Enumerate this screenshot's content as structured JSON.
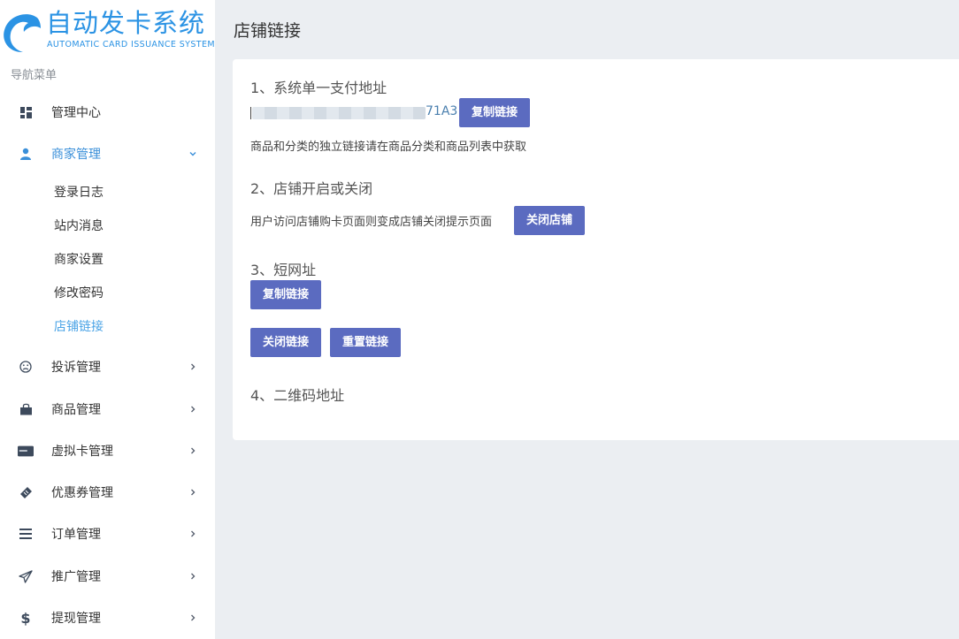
{
  "brand": {
    "title": "自动发卡系统",
    "subtitle": "AUTOMATIC CARD ISSUANCE SYSTEM",
    "color": "#2b93e4"
  },
  "sidebar": {
    "heading": "导航菜单",
    "items": [
      {
        "label": "管理中心",
        "icon": "dashboard-icon"
      },
      {
        "label": "商家管理",
        "icon": "user-icon",
        "expanded": true,
        "children": [
          "登录日志",
          "站内消息",
          "商家设置",
          "修改密码",
          "店铺链接"
        ],
        "current": "店铺链接"
      },
      {
        "label": "投诉管理",
        "icon": "frown-icon"
      },
      {
        "label": "商品管理",
        "icon": "shopping-bag-icon"
      },
      {
        "label": "虚拟卡管理",
        "icon": "card-icon"
      },
      {
        "label": "优惠券管理",
        "icon": "ticket-icon"
      },
      {
        "label": "订单管理",
        "icon": "list-icon"
      },
      {
        "label": "推广管理",
        "icon": "paper-plane-icon"
      },
      {
        "label": "提现管理",
        "icon": "dollar-icon"
      }
    ]
  },
  "page": {
    "title": "店铺链接"
  },
  "sections": {
    "pay_url": {
      "title": "1、系统单一支付地址",
      "url_tail": "71A3",
      "copy_label": "复制链接",
      "note": "商品和分类的独立链接请在商品分类和商品列表中获取"
    },
    "shop_toggle": {
      "title": "2、店铺开启或关闭",
      "note": "用户访问店铺购卡页面则变成店铺关闭提示页面",
      "button_label": "关闭店铺"
    },
    "short_url": {
      "title": "3、短网址",
      "copy_label": "复制链接",
      "close_label": "关闭链接",
      "reset_label": "重置链接"
    },
    "qr": {
      "title": "4、二维码地址"
    }
  },
  "colors": {
    "accent": "#5b6bc0",
    "active_nav": "#3a8fd9",
    "background": "#ebeef2"
  }
}
